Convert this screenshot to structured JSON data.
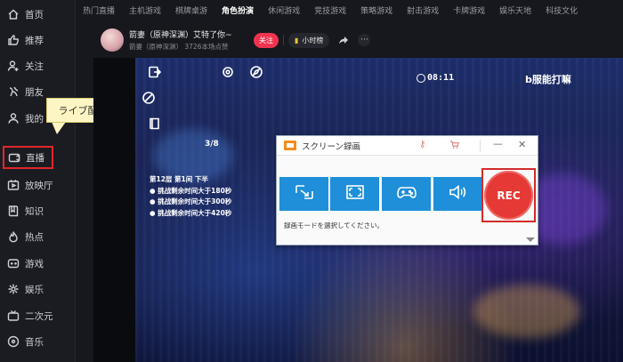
{
  "sidebar": {
    "items": [
      {
        "label": "首页",
        "icon": "home-icon"
      },
      {
        "label": "推荐",
        "icon": "thumbs-up-icon"
      },
      {
        "label": "关注",
        "icon": "user-plus-icon"
      },
      {
        "label": "朋友",
        "icon": "friends-icon"
      },
      {
        "label": "我的",
        "icon": "user-icon"
      },
      {
        "label": "直播",
        "icon": "live-tv-icon",
        "active": true
      },
      {
        "label": "放映厅",
        "icon": "cinema-icon"
      },
      {
        "label": "知识",
        "icon": "book-icon"
      },
      {
        "label": "热点",
        "icon": "flame-icon"
      },
      {
        "label": "游戏",
        "icon": "gamepad-icon"
      },
      {
        "label": "娱乐",
        "icon": "entertainment-icon"
      },
      {
        "label": "二次元",
        "icon": "tv-icon"
      },
      {
        "label": "音乐",
        "icon": "music-icon"
      }
    ]
  },
  "callout": {
    "label": "ライブ配信"
  },
  "topnav": {
    "tabs": [
      "热门直播",
      "主机游戏",
      "棋牌桌游",
      "角色扮演",
      "休闲游戏",
      "竞技游戏",
      "策略游戏",
      "射击游戏",
      "卡牌游戏",
      "娱乐天地",
      "科技文化"
    ],
    "active_index": 3
  },
  "streamer": {
    "name": "箭妻（原神深渊）艾特了你~",
    "meta": "箭妻（原神深渊）  3726本场点赞",
    "follow_label": "关注",
    "rank_label": "小时榜",
    "more_label": "···"
  },
  "video": {
    "timer": "08:11",
    "brand": "b服能打嘛",
    "counter": "3/8",
    "info_lines": [
      "第12层 第1间 下半",
      "● 挑战剩余时间大于180秒",
      "● 挑战剩余时间大于300秒",
      "● 挑战剩余时间大于420秒"
    ]
  },
  "recorder": {
    "title": "スクリーン録画",
    "modes": [
      "region-capture-icon",
      "fullscreen-icon",
      "game-mode-icon",
      "audio-icon"
    ],
    "rec_label": "REC",
    "hint": "録画モードを選択してください。",
    "minimize": "—",
    "close": "✕",
    "accent": "#1e8fd8",
    "rec_color": "#e53935"
  }
}
